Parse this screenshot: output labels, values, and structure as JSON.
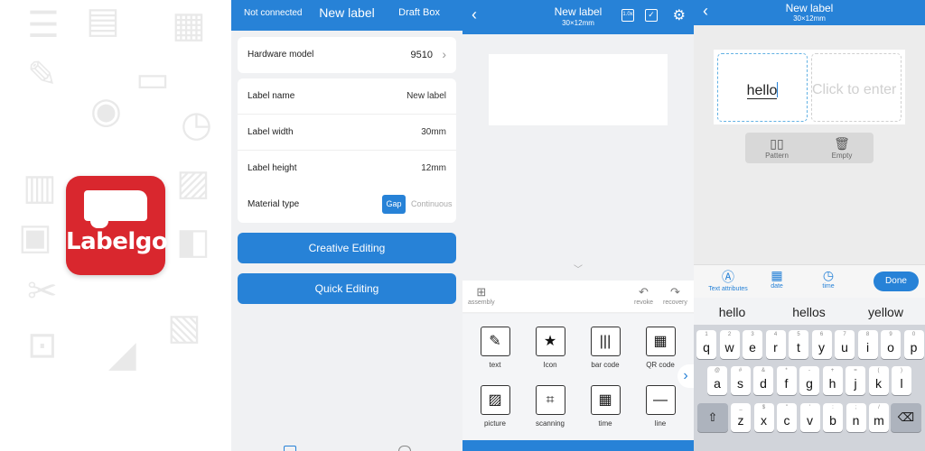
{
  "panel1": {
    "app_name": "Labelgo",
    "deco_icons": [
      {
        "glyph": "☰"
      },
      {
        "glyph": "▤"
      },
      {
        "glyph": "▦"
      },
      {
        "glyph": "✎"
      },
      {
        "glyph": "◉"
      },
      {
        "glyph": "▭"
      },
      {
        "glyph": "▥"
      },
      {
        "glyph": "◷"
      },
      {
        "glyph": "▨"
      },
      {
        "glyph": "▣"
      },
      {
        "glyph": "◧"
      },
      {
        "glyph": "✂"
      },
      {
        "glyph": "▧"
      },
      {
        "glyph": "⊡"
      },
      {
        "glyph": "◢"
      }
    ]
  },
  "panel2": {
    "status": "Not connected",
    "title": "New label",
    "draft": "Draft Box",
    "hardware_label": "Hardware model",
    "hardware_value": "9510",
    "settings": [
      {
        "label": "Label name",
        "value": "New label"
      },
      {
        "label": "Label width",
        "value": "30mm"
      },
      {
        "label": "Label height",
        "value": "12mm"
      }
    ],
    "material_label": "Material type",
    "material_options": [
      "Gap",
      "Continuous"
    ],
    "creative": "Creative Editing",
    "quick": "Quick Editing"
  },
  "panel3": {
    "title": "New label",
    "subtitle": "30×12mm",
    "zoom_icon": "1.0x",
    "assembly": "assembly",
    "revoke": "revoke",
    "recovery": "recovery",
    "tools": [
      {
        "label": "text",
        "glyph": "✎"
      },
      {
        "label": "Icon",
        "glyph": "★"
      },
      {
        "label": "bar code",
        "glyph": "|||"
      },
      {
        "label": "QR code",
        "glyph": "▦"
      },
      {
        "label": "picture",
        "glyph": "▨"
      },
      {
        "label": "scanning",
        "glyph": "⌗"
      },
      {
        "label": "time",
        "glyph": "▦"
      },
      {
        "label": "line",
        "glyph": "—"
      }
    ]
  },
  "panel4": {
    "title": "New label",
    "subtitle": "30×12mm",
    "cell_text": "hello",
    "cell_placeholder": "Click to enter",
    "pattern": "Pattern",
    "empty": "Empty",
    "kb_tools": [
      "Text attributes",
      "date",
      "time"
    ],
    "done": "Done",
    "suggestions": [
      "hello",
      "hellos",
      "yellow"
    ],
    "rows": [
      {
        "keys": [
          [
            "1",
            "q"
          ],
          [
            "2",
            "w"
          ],
          [
            "3",
            "e"
          ],
          [
            "4",
            "r"
          ],
          [
            "5",
            "t"
          ],
          [
            "6",
            "y"
          ],
          [
            "7",
            "u"
          ],
          [
            "8",
            "i"
          ],
          [
            "9",
            "o"
          ],
          [
            "0",
            "p"
          ]
        ]
      },
      {
        "keys": [
          [
            "@",
            "a"
          ],
          [
            "#",
            "s"
          ],
          [
            "&",
            "d"
          ],
          [
            "*",
            "f"
          ],
          [
            "-",
            "g"
          ],
          [
            "+",
            "h"
          ],
          [
            "=",
            "j"
          ],
          [
            "(",
            "k"
          ],
          [
            ")",
            "l"
          ]
        ]
      },
      {
        "keys": [
          [
            "_",
            "z"
          ],
          [
            "$",
            "x"
          ],
          [
            "\"",
            "c"
          ],
          [
            "'",
            "v"
          ],
          [
            ":",
            "b"
          ],
          [
            ";",
            "n"
          ],
          [
            "/",
            "m"
          ]
        ]
      }
    ],
    "shift": "⇧",
    "backspace": "⌫"
  }
}
